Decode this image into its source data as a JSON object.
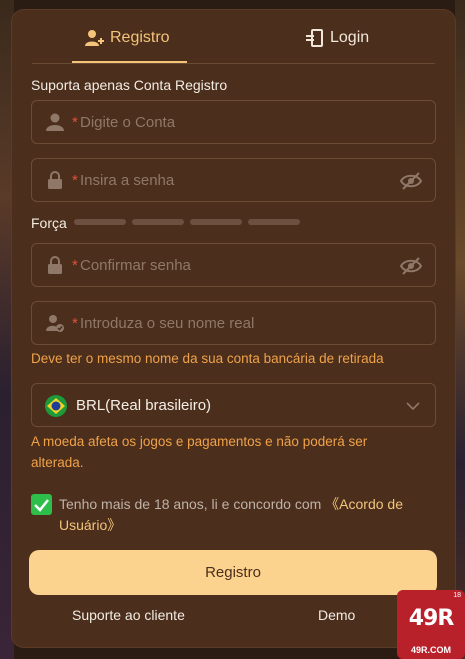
{
  "tabs": {
    "register": "Registro",
    "login": "Login"
  },
  "form": {
    "support_note": "Suporta apenas Conta Registro",
    "required_mark": "*",
    "account_placeholder": "Digite o Conta",
    "password_placeholder": "Insira a senha",
    "strength_label": "Força",
    "confirm_placeholder": "Confirmar senha",
    "realname_placeholder": "Introduza o seu nome real",
    "realname_hint": "Deve ter o mesmo nome da sua conta bancária de retirada",
    "currency_value": "BRL(Real brasileiro)",
    "currency_hint": "A moeda afeta os jogos e pagamentos e não poderá ser alterada.",
    "terms_text": "Tenho mais de 18 anos, li e concordo com",
    "terms_link": "《Acordo de Usuário》",
    "terms_checked": true,
    "submit_label": "Registro"
  },
  "footer": {
    "support": "Suporte ao cliente",
    "demo": "Demo"
  },
  "logo": {
    "text": "49R",
    "domain": "49R.COM",
    "age": "18"
  },
  "colors": {
    "accent": "#f3c47a",
    "panel": "#4b2e1c",
    "hint": "#f0a24a",
    "button": "#fcd28f",
    "check": "#2ebf4a"
  }
}
